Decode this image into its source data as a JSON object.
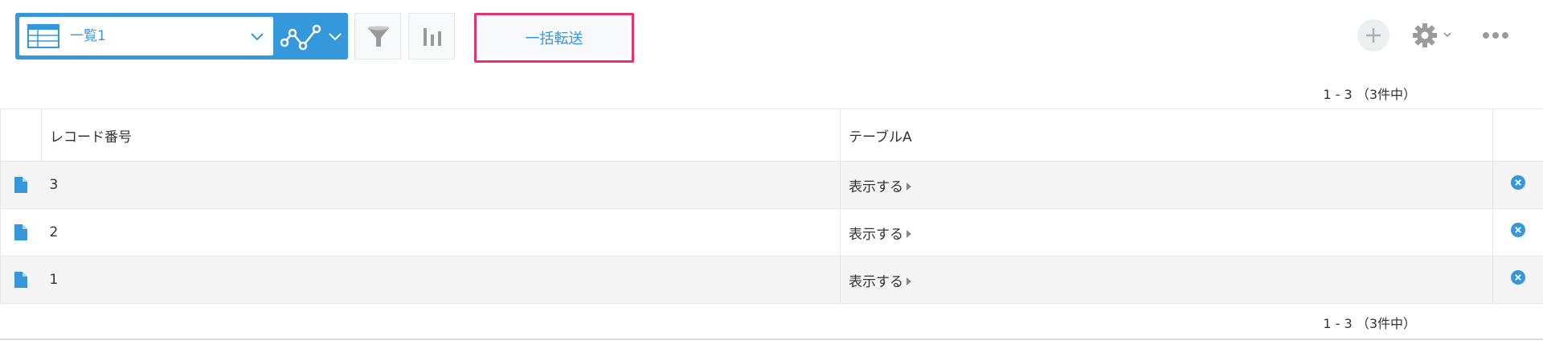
{
  "toolbar": {
    "view_name": "一覧1",
    "bulk_transfer_label": "一括転送"
  },
  "pager": {
    "top_text": "1 - 3 （3件中）",
    "bottom_text": "1 - 3 （3件中）"
  },
  "table": {
    "columns": [
      "",
      "レコード番号",
      "テーブルA",
      ""
    ],
    "rows": [
      {
        "record_number": "3",
        "table_a": "表示する"
      },
      {
        "record_number": "2",
        "table_a": "表示する"
      },
      {
        "record_number": "1",
        "table_a": "表示する"
      }
    ]
  },
  "icons": {
    "view": "table-icon",
    "graph": "line-graph-icon",
    "filter": "funnel-icon",
    "chart": "bar-chart-icon",
    "add": "plus-icon",
    "settings": "gear-icon",
    "more": "ellipsis-icon",
    "record": "document-icon",
    "delete": "close-circle-icon"
  },
  "colors": {
    "accent": "#3498db",
    "highlight_border": "#e5316f",
    "row_stripe": "#f5f5f5"
  }
}
